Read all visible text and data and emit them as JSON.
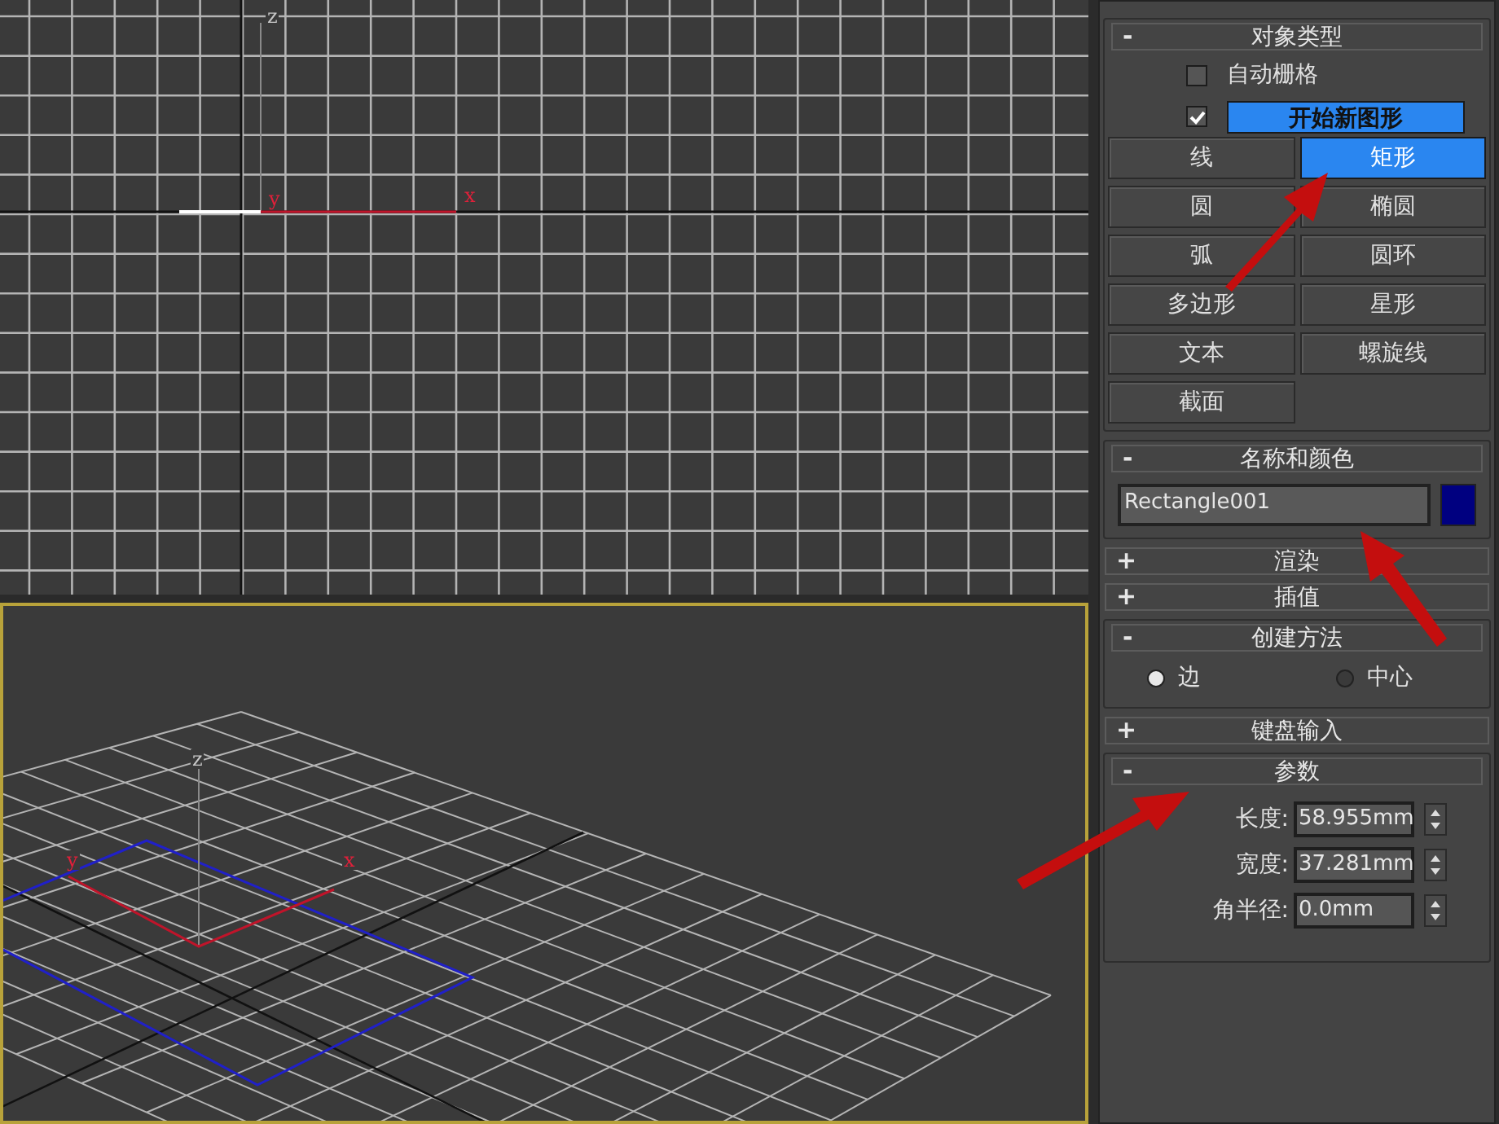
{
  "viewports": [
    {
      "kind": "ortho",
      "axis_labels": [
        {
          "kind": "z",
          "text": "z"
        },
        {
          "kind": "y",
          "text": "y"
        },
        {
          "kind": "x",
          "text": "x"
        }
      ],
      "active": false
    },
    {
      "kind": "perspective",
      "axis_labels": [
        {
          "kind": "z",
          "text": "z"
        },
        {
          "kind": "y",
          "text": "y"
        },
        {
          "kind": "x",
          "text": "x"
        }
      ],
      "active": true
    }
  ],
  "rollouts": [
    {
      "kind": "object_type",
      "title": "对象类型",
      "expanded": true,
      "sign": "-",
      "auto_grid": {
        "label": "自动栅格",
        "checked": false
      },
      "start_new_shape": {
        "label": "开始新图形",
        "checked": true
      },
      "buttons": [
        {
          "label": "线",
          "selected": false
        },
        {
          "label": "矩形",
          "selected": true
        },
        {
          "label": "圆",
          "selected": false
        },
        {
          "label": "椭圆",
          "selected": false
        },
        {
          "label": "弧",
          "selected": false
        },
        {
          "label": "圆环",
          "selected": false
        },
        {
          "label": "多边形",
          "selected": false
        },
        {
          "label": "星形",
          "selected": false
        },
        {
          "label": "文本",
          "selected": false
        },
        {
          "label": "螺旋线",
          "selected": false
        },
        {
          "label": "截面",
          "selected": false
        }
      ]
    },
    {
      "kind": "name_color",
      "title": "名称和颜色",
      "expanded": true,
      "sign": "-",
      "name": "Rectangle001",
      "color": "#000080"
    },
    {
      "kind": "collapsed",
      "title": "渲染",
      "expanded": false,
      "sign": "+"
    },
    {
      "kind": "collapsed",
      "title": "插值",
      "expanded": false,
      "sign": "+"
    },
    {
      "kind": "creation_method",
      "title": "创建方法",
      "expanded": true,
      "sign": "-",
      "options": [
        {
          "label": "边",
          "selected": true
        },
        {
          "label": "中心",
          "selected": false
        }
      ]
    },
    {
      "kind": "collapsed",
      "title": "键盘输入",
      "expanded": false,
      "sign": "+"
    },
    {
      "kind": "parameters",
      "title": "参数",
      "expanded": true,
      "sign": "-",
      "fields": [
        {
          "label": "长度:",
          "value": "58.955mm"
        },
        {
          "label": "宽度:",
          "value": "37.281mm"
        },
        {
          "label": "角半径:",
          "value": "0.0mm"
        }
      ]
    }
  ]
}
